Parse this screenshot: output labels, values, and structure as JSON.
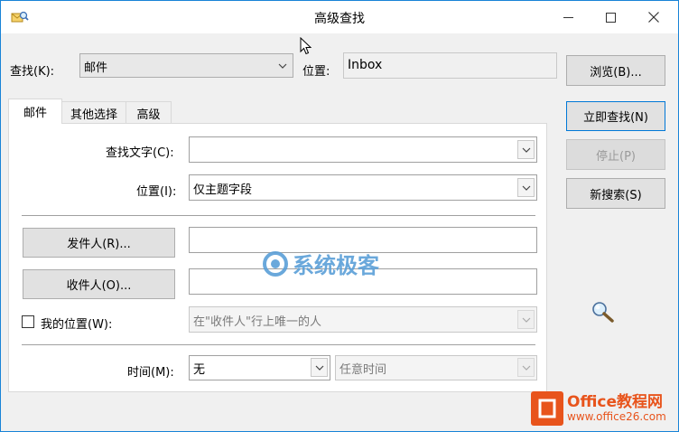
{
  "window": {
    "title": "高级查找"
  },
  "top": {
    "lookfor_label": "查找(K):",
    "lookfor_value": "邮件",
    "location_label": "位置:",
    "location_value": "Inbox"
  },
  "tabs": [
    {
      "label": "邮件"
    },
    {
      "label": "其他选择"
    },
    {
      "label": "高级"
    }
  ],
  "mail": {
    "search_text_label": "查找文字(C):",
    "search_text_value": "",
    "in_label": "位置(I):",
    "in_value": "仅主题字段",
    "from_button": "发件人(R)...",
    "from_value": "",
    "sent_to_button": "收件人(O)...",
    "sent_to_value": "",
    "where_label": "我的位置(W):",
    "where_value": "在\"收件人\"行上唯一的人",
    "time_label": "时间(M):",
    "time_value": "无",
    "time_range_value": "任意时间"
  },
  "buttons": {
    "browse": "浏览(B)...",
    "find_now": "立即查找(N)",
    "stop": "停止(P)",
    "new_search": "新搜索(S)"
  },
  "watermark": {
    "center": "系统极客",
    "brand": "Office教程网",
    "brand_url": "www.office26.com"
  },
  "icons": {
    "app": "advanced-find-icon",
    "magnifier": "search-animation-icon"
  }
}
